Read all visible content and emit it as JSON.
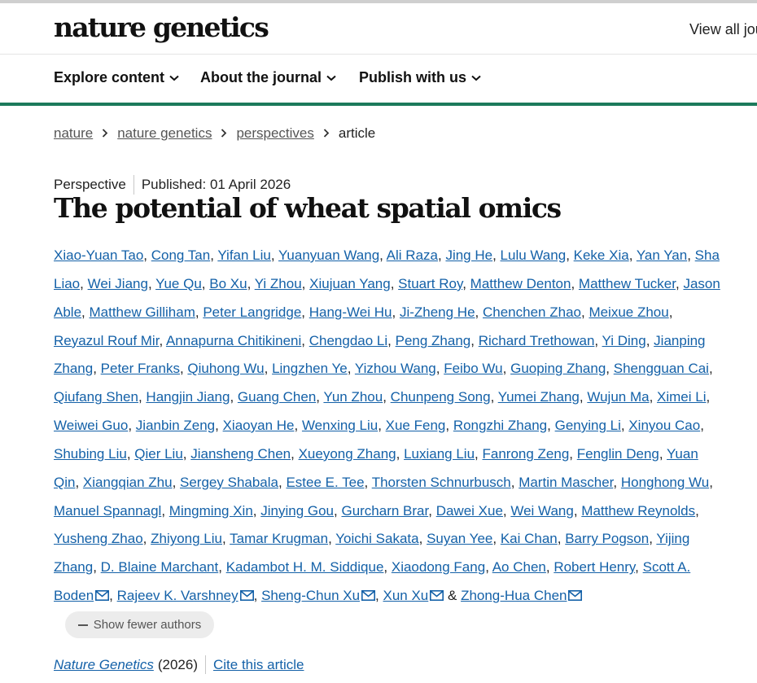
{
  "header": {
    "logo_text": "nature genetics",
    "view_all_text": "View all jou"
  },
  "nav": {
    "items": [
      {
        "label": "Explore content",
        "icon": "chevron-down-icon"
      },
      {
        "label": "About the journal",
        "icon": "chevron-down-icon"
      },
      {
        "label": "Publish with us",
        "icon": "chevron-down-icon"
      }
    ]
  },
  "breadcrumb": {
    "items": [
      "nature",
      "nature genetics",
      "perspectives"
    ],
    "current": "article"
  },
  "article": {
    "type": "Perspective",
    "published": "Published: 01 April 2026",
    "title": "The potential of wheat spatial omics",
    "author_lines": [
      [
        {
          "text": "Xiao-Yuan Tao"
        },
        {
          "sep": ", "
        },
        {
          "text": "Cong Tan"
        },
        {
          "sep": ", "
        },
        {
          "text": "Yifan Liu"
        },
        {
          "sep": ", "
        },
        {
          "text": "Yuanyuan Wang"
        },
        {
          "sep": ", "
        },
        {
          "text": "Ali Raza"
        },
        {
          "sep": ", "
        },
        {
          "text": "Jing He"
        },
        {
          "sep": ", "
        },
        {
          "text": "Lulu Wang"
        },
        {
          "sep": ", "
        },
        {
          "text": "Keke Xia"
        },
        {
          "sep": ", "
        },
        {
          "text": "Yan Yan"
        },
        {
          "sep": ", "
        },
        {
          "text": "Sha"
        }
      ],
      [
        {
          "text": "Liao"
        },
        {
          "sep": ", "
        },
        {
          "text": "Wei Jiang"
        },
        {
          "sep": ", "
        },
        {
          "text": "Yue Qu"
        },
        {
          "sep": ", "
        },
        {
          "text": "Bo Xu"
        },
        {
          "sep": ", "
        },
        {
          "text": "Yi Zhou"
        },
        {
          "sep": ", "
        },
        {
          "text": "Xiujuan Yang"
        },
        {
          "sep": ", "
        },
        {
          "text": "Stuart Roy"
        },
        {
          "sep": ", "
        },
        {
          "text": "Matthew Denton"
        },
        {
          "sep": ", "
        },
        {
          "text": "Matthew Tucker"
        },
        {
          "sep": ", "
        },
        {
          "text": "Jason"
        }
      ],
      [
        {
          "text": "Able"
        },
        {
          "sep": ", "
        },
        {
          "text": "Matthew Gilliham"
        },
        {
          "sep": ", "
        },
        {
          "text": "Peter Langridge"
        },
        {
          "sep": ", "
        },
        {
          "text": "Hang-Wei Hu"
        },
        {
          "sep": ", "
        },
        {
          "text": "Ji-Zheng He"
        },
        {
          "sep": ", "
        },
        {
          "text": "Chenchen Zhao"
        },
        {
          "sep": ", "
        },
        {
          "text": "Meixue Zhou"
        },
        {
          "sep": ","
        }
      ],
      [
        {
          "text": "Reyazul Rouf Mir"
        },
        {
          "sep": ", "
        },
        {
          "text": "Annapurna Chitikineni"
        },
        {
          "sep": ", "
        },
        {
          "text": "Chengdao Li"
        },
        {
          "sep": ", "
        },
        {
          "text": "Peng Zhang"
        },
        {
          "sep": ", "
        },
        {
          "text": "Richard Trethowan"
        },
        {
          "sep": ", "
        },
        {
          "text": "Yi Ding"
        },
        {
          "sep": ", "
        },
        {
          "text": "Jianping"
        }
      ],
      [
        {
          "text": "Zhang"
        },
        {
          "sep": ", "
        },
        {
          "text": "Peter Franks"
        },
        {
          "sep": ", "
        },
        {
          "text": "Qiuhong Wu"
        },
        {
          "sep": ", "
        },
        {
          "text": "Lingzhen Ye"
        },
        {
          "sep": ", "
        },
        {
          "text": "Yizhou Wang"
        },
        {
          "sep": ", "
        },
        {
          "text": "Feibo Wu"
        },
        {
          "sep": ", "
        },
        {
          "text": "Guoping Zhang"
        },
        {
          "sep": ", "
        },
        {
          "text": "Shengguan Cai"
        },
        {
          "sep": ","
        }
      ],
      [
        {
          "text": "Qiufang Shen"
        },
        {
          "sep": ", "
        },
        {
          "text": "Hangjin Jiang"
        },
        {
          "sep": ", "
        },
        {
          "text": "Guang Chen"
        },
        {
          "sep": ", "
        },
        {
          "text": "Yun Zhou"
        },
        {
          "sep": ", "
        },
        {
          "text": "Chunpeng Song"
        },
        {
          "sep": ", "
        },
        {
          "text": "Yumei Zhang"
        },
        {
          "sep": ", "
        },
        {
          "text": "Wujun Ma"
        },
        {
          "sep": ", "
        },
        {
          "text": "Ximei Li"
        },
        {
          "sep": ","
        }
      ],
      [
        {
          "text": "Weiwei Guo"
        },
        {
          "sep": ", "
        },
        {
          "text": "Jianbin Zeng"
        },
        {
          "sep": ", "
        },
        {
          "text": "Xiaoyan He"
        },
        {
          "sep": ", "
        },
        {
          "text": "Wenxing Liu"
        },
        {
          "sep": ", "
        },
        {
          "text": "Xue Feng"
        },
        {
          "sep": ", "
        },
        {
          "text": "Rongzhi Zhang"
        },
        {
          "sep": ", "
        },
        {
          "text": "Genying Li"
        },
        {
          "sep": ", "
        },
        {
          "text": "Xinyou Cao"
        },
        {
          "sep": ","
        }
      ],
      [
        {
          "text": "Shubing Liu"
        },
        {
          "sep": ", "
        },
        {
          "text": "Qier Liu"
        },
        {
          "sep": ", "
        },
        {
          "text": "Jiansheng Chen"
        },
        {
          "sep": ", "
        },
        {
          "text": "Xueyong Zhang"
        },
        {
          "sep": ", "
        },
        {
          "text": "Luxiang Liu"
        },
        {
          "sep": ", "
        },
        {
          "text": "Fanrong Zeng"
        },
        {
          "sep": ", "
        },
        {
          "text": "Fenglin Deng"
        },
        {
          "sep": ", "
        },
        {
          "text": "Yuan"
        }
      ],
      [
        {
          "text": "Qin"
        },
        {
          "sep": ", "
        },
        {
          "text": "Xiangqian Zhu"
        },
        {
          "sep": ", "
        },
        {
          "text": "Sergey Shabala"
        },
        {
          "sep": ", "
        },
        {
          "text": "Estee E. Tee"
        },
        {
          "sep": ", "
        },
        {
          "text": "Thorsten Schnurbusch"
        },
        {
          "sep": ", "
        },
        {
          "text": "Martin Mascher"
        },
        {
          "sep": ", "
        },
        {
          "text": "Honghong Wu"
        },
        {
          "sep": ","
        }
      ],
      [
        {
          "text": "Manuel Spannagl"
        },
        {
          "sep": ", "
        },
        {
          "text": "Mingming Xin"
        },
        {
          "sep": ", "
        },
        {
          "text": "Jinying Gou"
        },
        {
          "sep": ", "
        },
        {
          "text": "Gurcharn Brar"
        },
        {
          "sep": ", "
        },
        {
          "text": "Dawei Xue"
        },
        {
          "sep": ", "
        },
        {
          "text": "Wei Wang"
        },
        {
          "sep": ", "
        },
        {
          "text": "Matthew Reynolds"
        },
        {
          "sep": ","
        }
      ],
      [
        {
          "text": "Yusheng Zhao"
        },
        {
          "sep": ", "
        },
        {
          "text": "Zhiyong Liu"
        },
        {
          "sep": ", "
        },
        {
          "text": "Tamar Krugman"
        },
        {
          "sep": ", "
        },
        {
          "text": "Yoichi Sakata"
        },
        {
          "sep": ", "
        },
        {
          "text": "Suyan Yee"
        },
        {
          "sep": ", "
        },
        {
          "text": "Kai Chan"
        },
        {
          "sep": ", "
        },
        {
          "text": "Barry Pogson"
        },
        {
          "sep": ", "
        },
        {
          "text": "Yijing"
        }
      ],
      [
        {
          "text": "Zhang"
        },
        {
          "sep": ", "
        },
        {
          "text": "D. Blaine Marchant"
        },
        {
          "sep": ", "
        },
        {
          "text": "Kadambot H. M. Siddique"
        },
        {
          "sep": ", "
        },
        {
          "text": "Xiaodong Fang"
        },
        {
          "sep": ", "
        },
        {
          "text": "Ao Chen"
        },
        {
          "sep": ", "
        },
        {
          "text": "Robert Henry"
        },
        {
          "sep": ", "
        },
        {
          "text": "Scott A."
        }
      ],
      [
        {
          "text": "Boden",
          "mail": true
        },
        {
          "sep": ", "
        },
        {
          "text": "Rajeev K. Varshney",
          "mail": true
        },
        {
          "sep": ", "
        },
        {
          "text": "Sheng-Chun Xu",
          "mail": true
        },
        {
          "sep": ", "
        },
        {
          "text": "Xun Xu",
          "mail": true
        },
        {
          "sep": " & "
        },
        {
          "text": "Zhong-Hua Chen",
          "mail": true
        }
      ]
    ],
    "show_fewer_label": "Show fewer authors",
    "journal": "Nature Genetics",
    "year": "(2026)",
    "cite_label": "Cite this article"
  },
  "colors": {
    "link": "#1461a8",
    "accent_bar": "#1c7a5b"
  }
}
